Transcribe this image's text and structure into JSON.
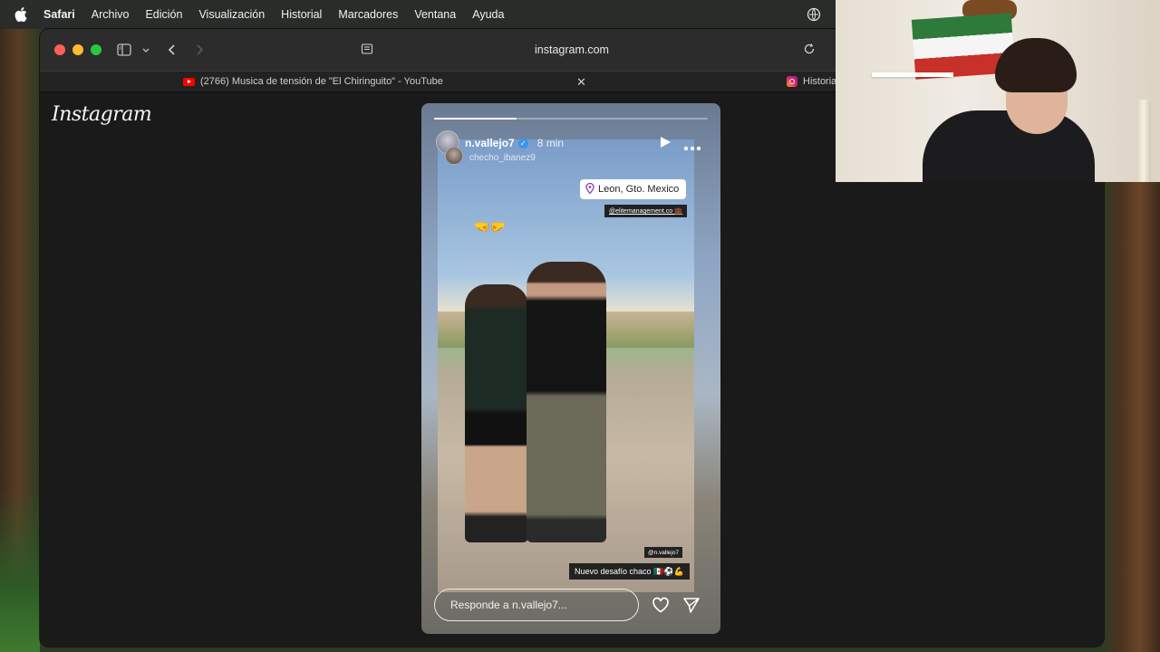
{
  "menubar": {
    "items": [
      "Safari",
      "Archivo",
      "Edición",
      "Visualización",
      "Historial",
      "Marcadores",
      "Ventana",
      "Ayuda"
    ]
  },
  "browser": {
    "url": "instagram.com",
    "tabs": [
      {
        "title": "(2766) Musica de tensión de \"El Chiringuito\" - YouTube",
        "icon": "youtube-icon"
      },
      {
        "title": "Historia",
        "icon": "instagram-icon"
      }
    ]
  },
  "instagram": {
    "logo": "Instagram",
    "story": {
      "progress": 0.3,
      "username": "n.vallejo7",
      "time": "8 min",
      "collaborator": "checho_ibanez9",
      "location": "Leon, Gto. Mexico",
      "mention_top": "@elitemanagement.co 💼",
      "emoji_hands": "🤜🤛",
      "mention_bottom": "@n.vallejo7",
      "caption": "Nuevo desafío chaco 🇲🇽⚽💪",
      "reply_placeholder": "Responde a n.vallejo7..."
    }
  },
  "colors": {
    "accent_verified": "#3897f0",
    "traffic_red": "#ff5f57",
    "traffic_yellow": "#febc2e",
    "traffic_green": "#28c840"
  }
}
